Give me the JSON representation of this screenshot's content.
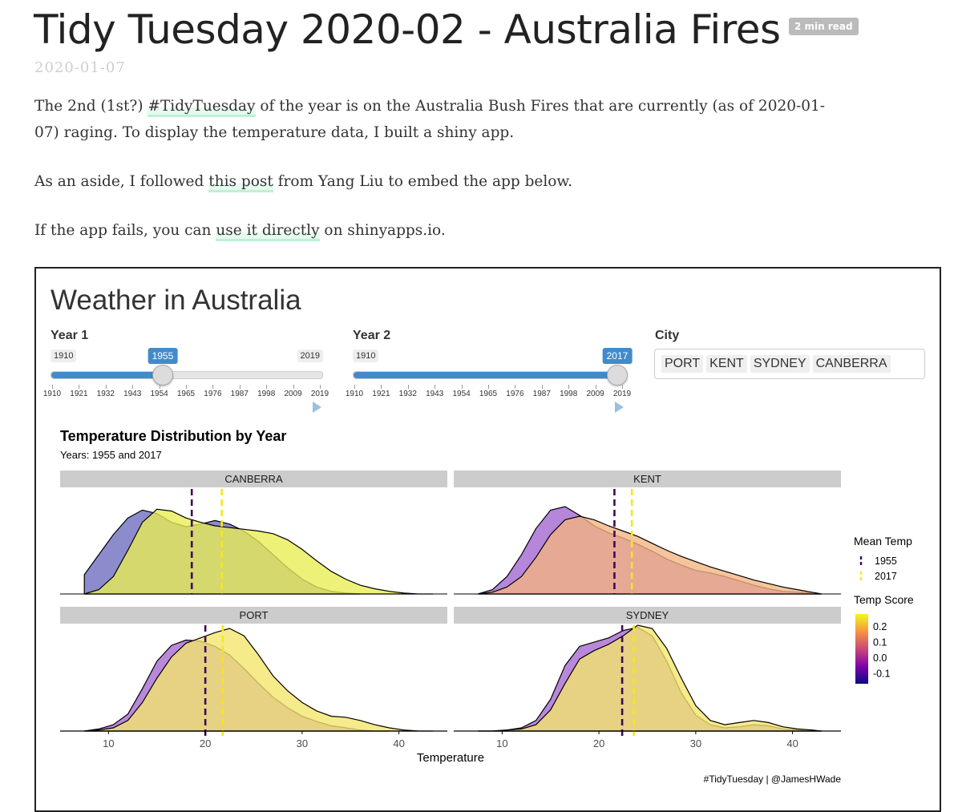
{
  "post": {
    "title": "Tidy Tuesday 2020-02 - Australia Fires",
    "read_time": "2 min read",
    "date": "2020-01-07",
    "p1": {
      "pre": "The 2nd (1st?) ",
      "link": "#TidyTuesday",
      "post": " of the year is on the Australia Bush Fires that are currently (as of 2020-01-07) raging. To display the temperature data, I built a shiny app."
    },
    "p2": {
      "pre": "As an aside, I followed ",
      "link": "this post",
      "post": " from Yang Liu to embed the app below."
    },
    "p3": {
      "pre": "If the app fails, you can ",
      "link": "use it directly",
      "post": " on shinyapps.io."
    }
  },
  "app": {
    "title": "Weather in Australia",
    "year1": {
      "label": "Year 1",
      "min": "1910",
      "max": "2019",
      "value": "1955",
      "fraction": 0.413,
      "ticks": [
        "1910",
        "1921",
        "1932",
        "1943",
        "1954",
        "1965",
        "1976",
        "1987",
        "1998",
        "2009",
        "2019"
      ]
    },
    "year2": {
      "label": "Year 2",
      "min": "1910",
      "max": "2019",
      "value": "2017",
      "fraction": 0.982,
      "ticks": [
        "1910",
        "1921",
        "1932",
        "1943",
        "1954",
        "1965",
        "1976",
        "1987",
        "1998",
        "2009",
        "2019"
      ]
    },
    "city": {
      "label": "City",
      "selected": [
        "PORT",
        "KENT",
        "SYDNEY",
        "CANBERRA"
      ]
    },
    "colors": {
      "accent": "#428bca"
    }
  },
  "chart_data": {
    "type": "area",
    "title": "Temperature Distribution by Year",
    "subtitle": "Years: 1955 and 2017",
    "xlabel": "Temperature",
    "ylabel": "",
    "xlim": [
      5,
      45
    ],
    "x_ticks": [
      "10",
      "20",
      "30",
      "40"
    ],
    "caption": "#TidyTuesday | @JamesHWade",
    "legend": {
      "mean_title": "Mean Temp",
      "mean_items": [
        {
          "label": "1955",
          "color": "#3d0a57"
        },
        {
          "label": "2017",
          "color": "#f5e61e"
        }
      ],
      "score_title": "Temp Score",
      "score_labels": [
        "0.2",
        "0.1",
        "0.0",
        "-0.1"
      ],
      "score_colors": [
        "#0d0887",
        "#7e03a8",
        "#cc4778",
        "#f89540",
        "#f0f921"
      ]
    },
    "panels": [
      {
        "name": "CANBERRA",
        "series": [
          {
            "year": "1955",
            "mean": 18.6,
            "fill": "#6b6cbf",
            "x": [
              7.5,
              9,
              10.5,
              12,
              13.5,
              15,
              16.5,
              18,
              19.5,
              21,
              22.5,
              24,
              25.5,
              27,
              28.5,
              30,
              31.5,
              33,
              34.5,
              36
            ],
            "y": [
              0.22,
              0.45,
              0.68,
              0.87,
              0.96,
              0.92,
              0.82,
              0.77,
              0.8,
              0.84,
              0.8,
              0.72,
              0.6,
              0.45,
              0.3,
              0.17,
              0.08,
              0.03,
              0.01,
              0
            ]
          },
          {
            "year": "2017",
            "mean": 21.7,
            "fill": "#e9ed52",
            "x": [
              7.5,
              9,
              10.5,
              12,
              13.5,
              15,
              16.5,
              18,
              19.5,
              21,
              22.5,
              24,
              25.5,
              27,
              28.5,
              30,
              31.5,
              33,
              34.5,
              36,
              37.5,
              39,
              40.5,
              42,
              43.5
            ],
            "y": [
              0,
              0.05,
              0.2,
              0.5,
              0.82,
              0.97,
              0.95,
              0.87,
              0.82,
              0.78,
              0.76,
              0.74,
              0.72,
              0.69,
              0.62,
              0.51,
              0.38,
              0.26,
              0.17,
              0.1,
              0.06,
              0.03,
              0.01,
              0,
              0
            ]
          }
        ]
      },
      {
        "name": "KENT",
        "series": [
          {
            "year": "1955",
            "mean": 21.6,
            "fill": "#a064cf",
            "x": [
              7.5,
              9,
              10.5,
              12,
              13.5,
              15,
              16.5,
              18,
              19.5,
              21,
              22.5,
              24,
              25.5,
              27,
              28.5,
              30,
              31.5,
              33,
              34.5,
              36,
              37.5,
              39,
              40.5,
              42,
              43
            ],
            "y": [
              0,
              0.05,
              0.2,
              0.45,
              0.75,
              0.96,
              1.0,
              0.9,
              0.78,
              0.7,
              0.64,
              0.57,
              0.49,
              0.4,
              0.33,
              0.27,
              0.24,
              0.2,
              0.15,
              0.1,
              0.06,
              0.03,
              0.02,
              0.01,
              0
            ]
          },
          {
            "year": "2017",
            "mean": 23.4,
            "fill": "#f3b480",
            "x": [
              7.5,
              9,
              10.5,
              12,
              13.5,
              15,
              16.5,
              18,
              19.5,
              21,
              22.5,
              24,
              25.5,
              27,
              28.5,
              30,
              31.5,
              33,
              34.5,
              36,
              37.5,
              39,
              40.5,
              42,
              43
            ],
            "y": [
              0,
              0.02,
              0.08,
              0.2,
              0.42,
              0.68,
              0.85,
              0.89,
              0.85,
              0.78,
              0.72,
              0.66,
              0.58,
              0.5,
              0.43,
              0.37,
              0.31,
              0.26,
              0.21,
              0.16,
              0.12,
              0.08,
              0.05,
              0.02,
              0
            ]
          }
        ]
      },
      {
        "name": "PORT",
        "series": [
          {
            "year": "1955",
            "mean": 20.0,
            "fill": "#a567d1",
            "x": [
              7.5,
              9,
              10.5,
              12,
              13.5,
              15,
              16.5,
              18,
              19.5,
              21,
              22.5,
              24,
              25.5,
              27,
              28.5,
              30,
              31.5,
              33,
              34.5,
              36,
              37.5,
              39
            ],
            "y": [
              0,
              0.02,
              0.06,
              0.16,
              0.4,
              0.66,
              0.81,
              0.86,
              0.85,
              0.8,
              0.72,
              0.59,
              0.45,
              0.32,
              0.22,
              0.14,
              0.09,
              0.05,
              0.03,
              0.01,
              0,
              0
            ]
          },
          {
            "year": "2017",
            "mean": 21.8,
            "fill": "#f3e66a",
            "x": [
              7.5,
              9,
              10.5,
              12,
              13.5,
              15,
              16.5,
              18,
              19.5,
              21,
              22.5,
              24,
              25.5,
              27,
              28.5,
              30,
              31.5,
              33,
              34.5,
              36,
              37.5,
              39,
              40.5,
              42,
              43.5
            ],
            "y": [
              0,
              0.01,
              0.03,
              0.1,
              0.27,
              0.5,
              0.7,
              0.83,
              0.88,
              0.93,
              0.97,
              0.9,
              0.72,
              0.52,
              0.38,
              0.27,
              0.19,
              0.14,
              0.13,
              0.1,
              0.06,
              0.03,
              0.01,
              0,
              0
            ]
          }
        ]
      },
      {
        "name": "SYDNEY",
        "series": [
          {
            "year": "1955",
            "mean": 22.4,
            "fill": "#a567d1",
            "x": [
              7.5,
              9,
              10.5,
              12,
              13.5,
              15,
              16.5,
              18,
              19.5,
              21,
              22.5,
              24,
              25.5,
              27,
              28.5,
              30,
              31.5,
              33,
              34.5,
              36,
              37.5,
              39,
              40.5,
              42,
              43
            ],
            "y": [
              0,
              0,
              0.01,
              0.03,
              0.1,
              0.3,
              0.62,
              0.8,
              0.84,
              0.88,
              0.95,
              0.98,
              0.9,
              0.66,
              0.36,
              0.15,
              0.06,
              0.03,
              0.04,
              0.06,
              0.05,
              0.02,
              0.01,
              0,
              0
            ]
          },
          {
            "year": "2017",
            "mean": 23.6,
            "fill": "#f3e66a",
            "x": [
              7.5,
              9,
              10.5,
              12,
              13.5,
              15,
              16.5,
              18,
              19.5,
              21,
              22.5,
              24,
              25.5,
              27,
              28.5,
              30,
              31.5,
              33,
              34.5,
              36,
              37.5,
              39,
              40.5,
              42,
              43
            ],
            "y": [
              0,
              0,
              0.01,
              0.02,
              0.06,
              0.2,
              0.45,
              0.68,
              0.76,
              0.82,
              0.9,
              1.0,
              0.97,
              0.78,
              0.5,
              0.24,
              0.1,
              0.06,
              0.08,
              0.1,
              0.08,
              0.04,
              0.02,
              0.01,
              0
            ]
          }
        ]
      }
    ]
  }
}
